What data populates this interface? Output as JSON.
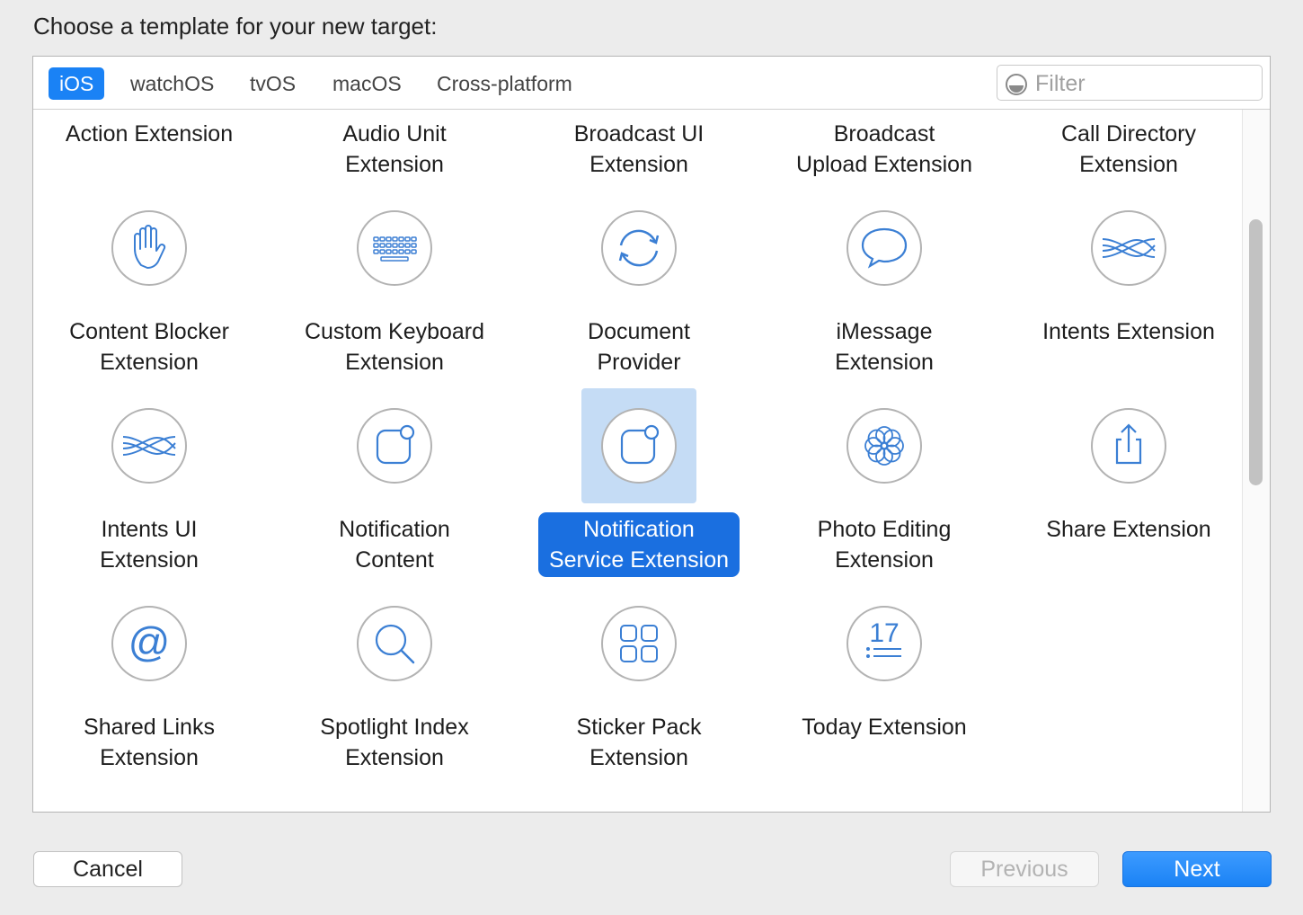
{
  "prompt": "Choose a template for your new target:",
  "tabs": [
    {
      "label": "iOS",
      "active": true
    },
    {
      "label": "watchOS",
      "active": false
    },
    {
      "label": "tvOS",
      "active": false
    },
    {
      "label": "macOS",
      "active": false
    },
    {
      "label": "Cross-platform",
      "active": false
    }
  ],
  "filter": {
    "placeholder": "Filter",
    "value": ""
  },
  "templates": [
    {
      "l1": "Action Extension",
      "l2": "",
      "icon": "action-icon"
    },
    {
      "l1": "Audio Unit",
      "l2": "Extension",
      "icon": "audio-unit-icon"
    },
    {
      "l1": "Broadcast UI",
      "l2": "Extension",
      "icon": "broadcast-ui-icon"
    },
    {
      "l1": "Broadcast",
      "l2": "Upload Extension",
      "icon": "broadcast-upload-icon"
    },
    {
      "l1": "Call Directory",
      "l2": "Extension",
      "icon": "call-directory-icon"
    },
    {
      "l1": "Content Blocker",
      "l2": "Extension",
      "icon": "hand-icon"
    },
    {
      "l1": "Custom Keyboard",
      "l2": "Extension",
      "icon": "keyboard-icon"
    },
    {
      "l1": "Document",
      "l2": "Provider",
      "icon": "sync-arrows-icon"
    },
    {
      "l1": "iMessage",
      "l2": "Extension",
      "icon": "speech-bubble-icon"
    },
    {
      "l1": "Intents Extension",
      "l2": "",
      "icon": "intents-wave-icon"
    },
    {
      "l1": "Intents UI",
      "l2": "Extension",
      "icon": "intents-wave-icon"
    },
    {
      "l1": "Notification",
      "l2": "Content",
      "icon": "notification-icon"
    },
    {
      "l1": "Notification",
      "l2": "Service Extension",
      "icon": "notification-icon"
    },
    {
      "l1": "Photo Editing",
      "l2": "Extension",
      "icon": "flower-icon"
    },
    {
      "l1": "Share Extension",
      "l2": "",
      "icon": "share-icon"
    },
    {
      "l1": "Shared Links",
      "l2": "Extension",
      "icon": "at-sign-icon"
    },
    {
      "l1": "Spotlight Index",
      "l2": "Extension",
      "icon": "magnifier-icon"
    },
    {
      "l1": "Sticker Pack",
      "l2": "Extension",
      "icon": "four-squares-icon"
    },
    {
      "l1": "Today Extension",
      "l2": "",
      "icon": "today-calendar-icon"
    }
  ],
  "today_icon_day": "17",
  "selected_template_index": 12,
  "colors": {
    "accent": "#1a82f5",
    "icon_stroke": "#3b7fd4",
    "selection_bg": "#c5dcf5",
    "selected_label_bg": "#1a6fe0"
  },
  "buttons": {
    "cancel": "Cancel",
    "previous": "Previous",
    "next": "Next",
    "previous_enabled": false
  }
}
